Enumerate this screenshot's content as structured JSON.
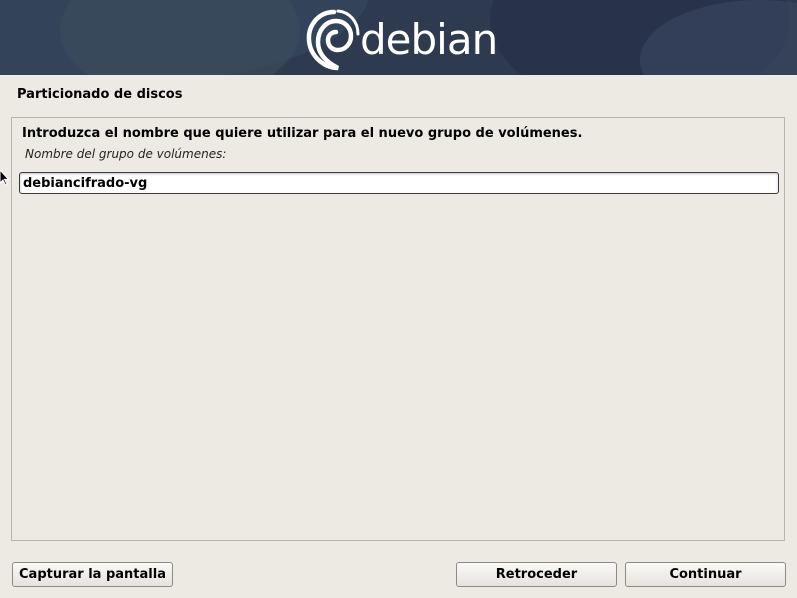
{
  "banner": {
    "logo_text": "debian",
    "colors": {
      "background": "#2d3a4f",
      "logo": "#ffffff"
    },
    "logo_icon": "debian-swirl-icon"
  },
  "page": {
    "title": "Particionado de discos"
  },
  "content": {
    "question": "Introduzca el nombre que quiere utilizar para el nuevo grupo de volúmenes.",
    "field_label": "Nombre del grupo de volúmenes:",
    "field_value": "debiancifrado-vg"
  },
  "buttons": {
    "screenshot": "Capturar la pantalla",
    "back": "Retroceder",
    "continue": "Continuar"
  },
  "cursor_icon": "mouse-pointer-icon"
}
